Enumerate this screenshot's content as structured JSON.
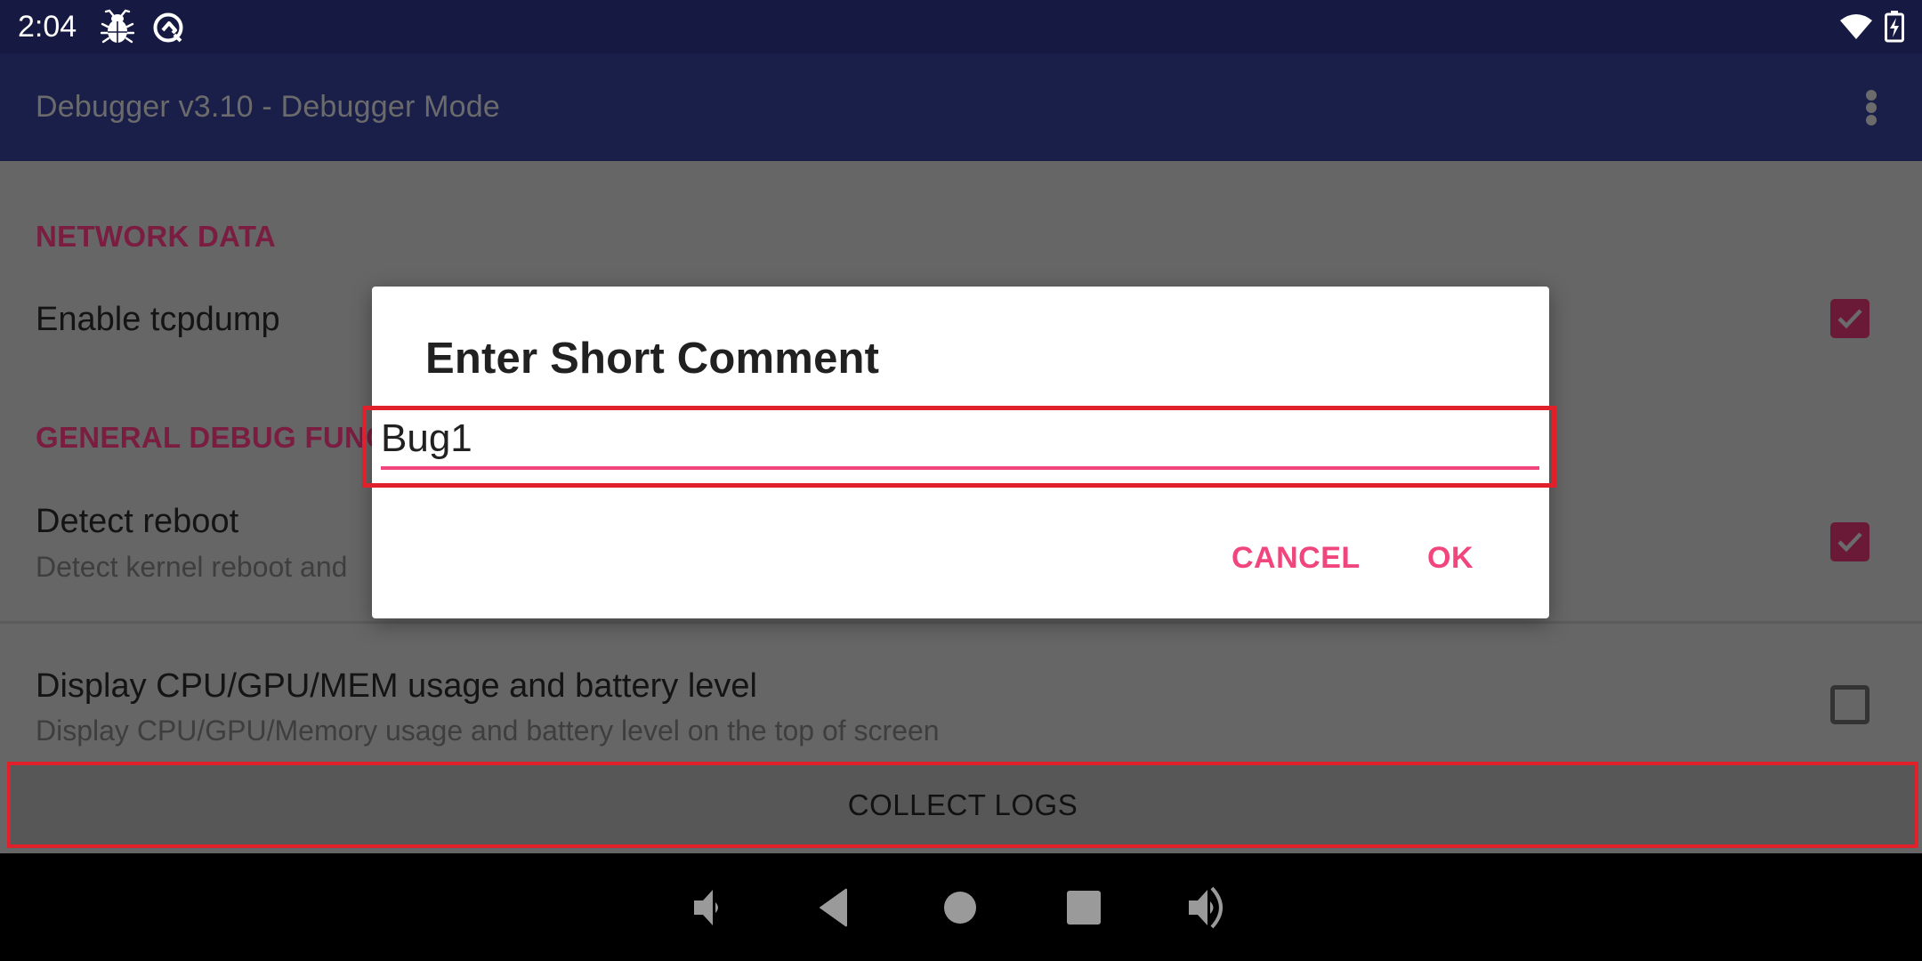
{
  "status_bar": {
    "time": "2:04",
    "icons": [
      "bug-icon",
      "q-logo-icon",
      "wifi-icon",
      "battery-charging-icon"
    ]
  },
  "app_bar": {
    "title": "Debugger v3.10 - Debugger Mode",
    "overflow_icon": "more-vert-icon"
  },
  "settings": {
    "sections": [
      {
        "header": "NETWORK DATA",
        "items": [
          {
            "title": "Enable tcpdump",
            "checked": true
          }
        ]
      },
      {
        "header": "GENERAL DEBUG FUNC",
        "items": [
          {
            "title": "Detect reboot",
            "subtitle": "Detect kernel reboot and",
            "checked": true
          },
          {
            "title": "Display CPU/GPU/MEM usage and battery level",
            "subtitle": "Display CPU/GPU/Memory usage and battery level on the top of screen",
            "checked": false
          }
        ]
      }
    ]
  },
  "collect_logs": {
    "label": "COLLECT LOGS"
  },
  "dialog": {
    "title": "Enter Short Comment",
    "input_value": "Bug1",
    "cancel_label": "CANCEL",
    "ok_label": "OK"
  },
  "nav_bar": {
    "buttons": [
      "volume-down-icon",
      "back-icon",
      "home-icon",
      "recents-icon",
      "volume-up-icon"
    ]
  },
  "colors": {
    "status_bar": "#161a42",
    "app_bar": "#1a1f4a",
    "accent": "#f0457d",
    "section_header_dimmed": "#7a1d40",
    "highlight_box": "#e0212b"
  }
}
